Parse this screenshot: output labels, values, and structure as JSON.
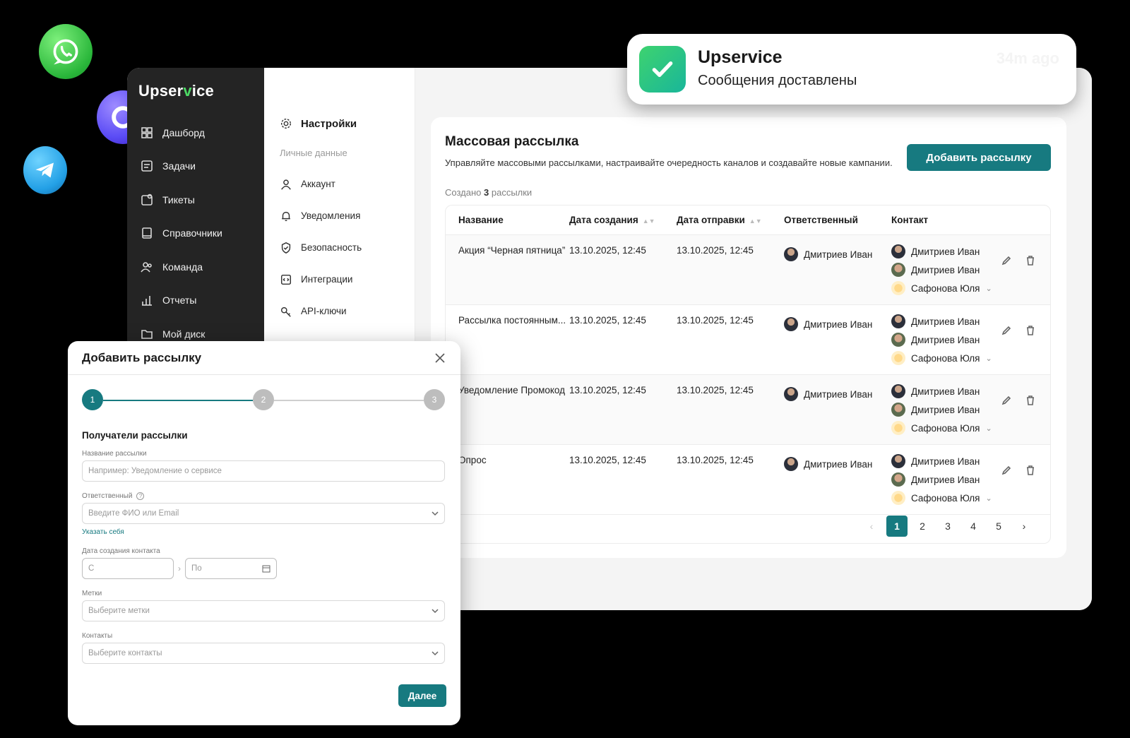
{
  "app": {
    "logo_part1": "Upser",
    "logo_v": "v",
    "logo_part2": "ice"
  },
  "sidebar": {
    "items": [
      {
        "label": "Дашборд",
        "icon": "dashboard-icon"
      },
      {
        "label": "Задачи",
        "icon": "tasks-icon"
      },
      {
        "label": "Тикеты",
        "icon": "tickets-icon"
      },
      {
        "label": "Справочники",
        "icon": "book-icon"
      },
      {
        "label": "Команда",
        "icon": "team-icon"
      },
      {
        "label": "Отчеты",
        "icon": "chart-icon"
      },
      {
        "label": "Мой диск",
        "icon": "folder-icon"
      }
    ]
  },
  "settings": {
    "title": "Настройки",
    "section": "Личные данные",
    "items": [
      {
        "label": "Аккаунт",
        "icon": "user-icon"
      },
      {
        "label": "Уведомления",
        "icon": "bell-icon"
      },
      {
        "label": "Безопасность",
        "icon": "shield-icon"
      },
      {
        "label": "Интеграции",
        "icon": "code-icon"
      },
      {
        "label": "API-ключи",
        "icon": "key-icon"
      }
    ]
  },
  "main": {
    "title": "Массовая рассылка",
    "description": "Управляйте массовыми рассылками, настраивайте очередность каналов и создавайте новые кампании.",
    "add_button": "Добавить рассылку",
    "created_prefix": "Создано",
    "created_count": "3",
    "created_suffix": "рассылки",
    "columns": [
      "Название",
      "Дата создания",
      "Дата отправки",
      "Ответственный",
      "Контакт"
    ],
    "rows": [
      {
        "name": "Акция “Черная пятница”",
        "created": "13.10.2025, 12:45",
        "sent": "13.10.2025, 12:45",
        "responsible": "Дмитриев Иван",
        "contacts": [
          "Дмитриев Иван",
          "Дмитриев Иван",
          "Сафонова Юля"
        ]
      },
      {
        "name": "Рассылка постоянным...",
        "created": "13.10.2025, 12:45",
        "sent": "13.10.2025, 12:45",
        "responsible": "Дмитриев Иван",
        "contacts": [
          "Дмитриев Иван",
          "Дмитриев Иван",
          "Сафонова Юля"
        ]
      },
      {
        "name": "Уведомление Промокод",
        "created": "13.10.2025, 12:45",
        "sent": "13.10.2025, 12:45",
        "responsible": "Дмитриев Иван",
        "contacts": [
          "Дмитриев Иван",
          "Дмитриев Иван",
          "Сафонова Юля"
        ]
      },
      {
        "name": "Опрос",
        "created": "13.10.2025, 12:45",
        "sent": "13.10.2025, 12:45",
        "responsible": "Дмитриев Иван",
        "contacts": [
          "Дмитриев Иван",
          "Дмитриев Иван",
          "Сафонова Юля"
        ]
      }
    ],
    "pagination": {
      "pages": [
        "1",
        "2",
        "3",
        "4",
        "5"
      ],
      "current": "1",
      "prev": "‹",
      "next": "›"
    }
  },
  "notification": {
    "title": "Upservice",
    "text": "Сообщения доставлены",
    "time": "34m ago"
  },
  "modal": {
    "title": "Добавить рассылку",
    "steps": [
      "1",
      "2",
      "3"
    ],
    "current_step": 1,
    "section": "Получатели рассылки",
    "name_label": "Название рассылки",
    "name_placeholder": "Например: Уведомление о сервисе",
    "resp_label": "Ответственный",
    "resp_help": "?",
    "resp_placeholder": "Введите ФИО или Email",
    "self_link": "Указать себя",
    "date_label": "Дата создания контакта",
    "date_from": "С",
    "date_to": "По",
    "tags_label": "Метки",
    "tags_placeholder": "Выберите метки",
    "contacts_label": "Контакты",
    "contacts_placeholder": "Выберите контакты",
    "next_button": "Далее"
  },
  "colors": {
    "accent": "#177a80",
    "sidebar_bg": "#242424",
    "brand_green": "#4cd964"
  }
}
